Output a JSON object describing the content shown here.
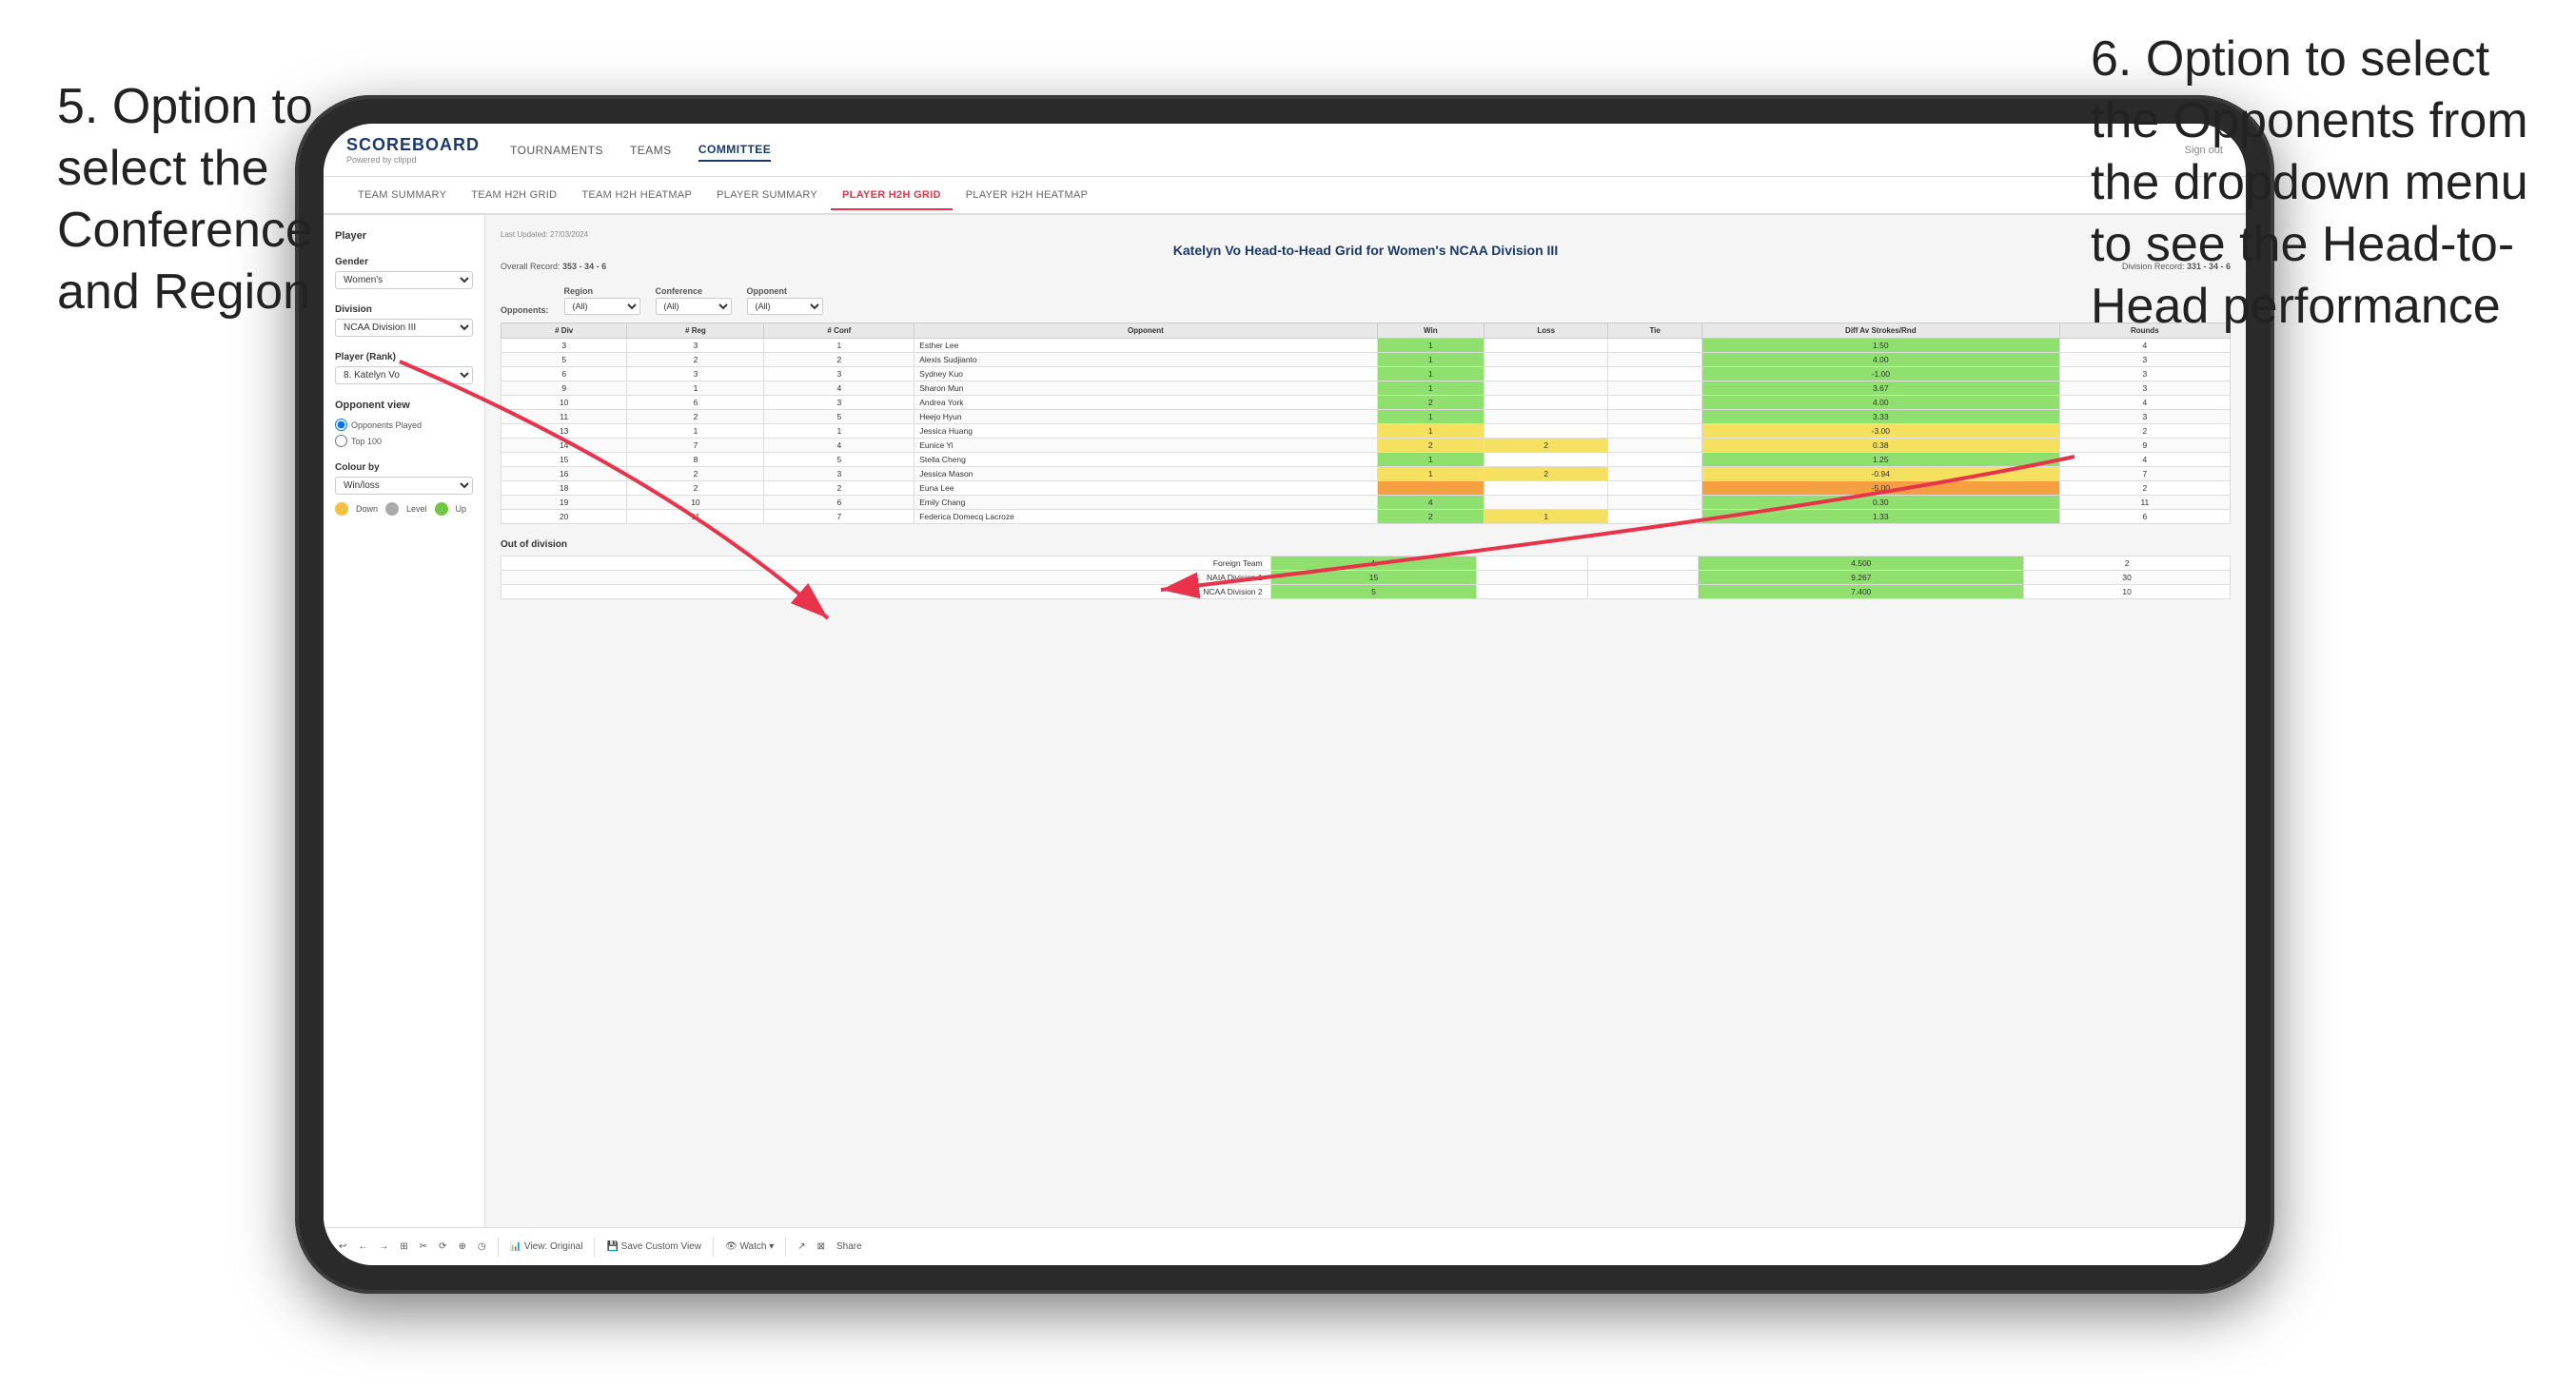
{
  "annotations": {
    "left": {
      "text": "5. Option to select the Conference and Region"
    },
    "right": {
      "text": "6. Option to select the Opponents from the dropdown menu to see the Head-to-Head performance"
    }
  },
  "nav": {
    "logo": "SCOREBOARD",
    "logo_sub": "Powered by clippd",
    "items": [
      "TOURNAMENTS",
      "TEAMS",
      "COMMITTEE"
    ],
    "active": "COMMITTEE",
    "sign_out": "Sign out"
  },
  "sub_nav": {
    "items": [
      "TEAM SUMMARY",
      "TEAM H2H GRID",
      "TEAM H2H HEATMAP",
      "PLAYER SUMMARY",
      "PLAYER H2H GRID",
      "PLAYER H2H HEATMAP"
    ],
    "active": "PLAYER H2H GRID"
  },
  "sidebar": {
    "player_label": "Player",
    "gender_label": "Gender",
    "gender_value": "Women's",
    "division_label": "Division",
    "division_value": "NCAA Division III",
    "player_rank_label": "Player (Rank)",
    "player_rank_value": "8. Katelyn Vo",
    "opponent_view_label": "Opponent view",
    "opponent_options": [
      "Opponents Played",
      "Top 100"
    ],
    "colour_by_label": "Colour by",
    "colour_by_value": "Win/loss",
    "colour_circles": [
      {
        "color": "#f5c040",
        "label": "Down"
      },
      {
        "color": "#aaaaaa",
        "label": "Level"
      },
      {
        "color": "#70c840",
        "label": "Up"
      }
    ]
  },
  "report": {
    "last_updated": "Last Updated: 27/03/2024",
    "title": "Katelyn Vo Head-to-Head Grid for Women's NCAA Division III",
    "overall_record_label": "Overall Record:",
    "overall_record": "353 - 34 - 6",
    "division_record_label": "Division Record:",
    "division_record": "331 - 34 - 6",
    "filters": {
      "opponents_label": "Opponents:",
      "region_label": "Region",
      "region_sublabel": "(All)",
      "conference_label": "Conference",
      "conference_sublabel": "(All)",
      "opponent_label": "Opponent",
      "opponent_sublabel": "(All)"
    },
    "table_headers": [
      "# Div",
      "# Reg",
      "# Conf",
      "Opponent",
      "Win",
      "Loss",
      "Tie",
      "Diff Av Strokes/Rnd",
      "Rounds"
    ],
    "rows": [
      {
        "div": "3",
        "reg": "3",
        "conf": "1",
        "opponent": "Esther Lee",
        "win": "1",
        "loss": "",
        "tie": "",
        "diff": "1.50",
        "rounds": "4",
        "win_color": "cell-green"
      },
      {
        "div": "5",
        "reg": "2",
        "conf": "2",
        "opponent": "Alexis Sudjianto",
        "win": "1",
        "loss": "",
        "tie": "",
        "diff": "4.00",
        "rounds": "3",
        "win_color": "cell-green"
      },
      {
        "div": "6",
        "reg": "3",
        "conf": "3",
        "opponent": "Sydney Kuo",
        "win": "1",
        "loss": "",
        "tie": "",
        "diff": "-1.00",
        "rounds": "3",
        "win_color": "cell-green"
      },
      {
        "div": "9",
        "reg": "1",
        "conf": "4",
        "opponent": "Sharon Mun",
        "win": "1",
        "loss": "",
        "tie": "",
        "diff": "3.67",
        "rounds": "3",
        "win_color": "cell-green"
      },
      {
        "div": "10",
        "reg": "6",
        "conf": "3",
        "opponent": "Andrea York",
        "win": "2",
        "loss": "",
        "tie": "",
        "diff": "4.00",
        "rounds": "4",
        "win_color": "cell-green"
      },
      {
        "div": "11",
        "reg": "2",
        "conf": "5",
        "opponent": "Heejo Hyun",
        "win": "1",
        "loss": "",
        "tie": "",
        "diff": "3.33",
        "rounds": "3",
        "win_color": "cell-green"
      },
      {
        "div": "13",
        "reg": "1",
        "conf": "1",
        "opponent": "Jessica Huang",
        "win": "1",
        "loss": "",
        "tie": "",
        "diff": "-3.00",
        "rounds": "2",
        "win_color": "cell-yellow"
      },
      {
        "div": "14",
        "reg": "7",
        "conf": "4",
        "opponent": "Eunice Yi",
        "win": "2",
        "loss": "2",
        "tie": "",
        "diff": "0.38",
        "rounds": "9",
        "win_color": "cell-yellow"
      },
      {
        "div": "15",
        "reg": "8",
        "conf": "5",
        "opponent": "Stella Cheng",
        "win": "1",
        "loss": "",
        "tie": "",
        "diff": "1.25",
        "rounds": "4",
        "win_color": "cell-green"
      },
      {
        "div": "16",
        "reg": "2",
        "conf": "3",
        "opponent": "Jessica Mason",
        "win": "1",
        "loss": "2",
        "tie": "",
        "diff": "-0.94",
        "rounds": "7",
        "win_color": "cell-yellow"
      },
      {
        "div": "18",
        "reg": "2",
        "conf": "2",
        "opponent": "Euna Lee",
        "win": "",
        "loss": "",
        "tie": "",
        "diff": "-5.00",
        "rounds": "2",
        "win_color": "cell-orange"
      },
      {
        "div": "19",
        "reg": "10",
        "conf": "6",
        "opponent": "Emily Chang",
        "win": "4",
        "loss": "",
        "tie": "",
        "diff": "0.30",
        "rounds": "11",
        "win_color": "cell-green"
      },
      {
        "div": "20",
        "reg": "11",
        "conf": "7",
        "opponent": "Federica Domecq Lacroze",
        "win": "2",
        "loss": "1",
        "tie": "",
        "diff": "1.33",
        "rounds": "6",
        "win_color": "cell-green"
      }
    ],
    "out_of_division_title": "Out of division",
    "out_of_division_rows": [
      {
        "name": "Foreign Team",
        "win": "1",
        "loss": "",
        "tie": "",
        "diff": "4.500",
        "rounds": "2"
      },
      {
        "name": "NAIA Division 1",
        "win": "15",
        "loss": "",
        "tie": "",
        "diff": "9.267",
        "rounds": "30"
      },
      {
        "name": "NCAA Division 2",
        "win": "5",
        "loss": "",
        "tie": "",
        "diff": "7.400",
        "rounds": "10"
      }
    ]
  },
  "toolbar": {
    "items": [
      "↩",
      "←",
      "→",
      "⊞",
      "✂",
      "⟳",
      "⊕",
      "◷",
      "View: Original",
      "Save Custom View",
      "Watch ▾",
      "↗",
      "⊠",
      "Share"
    ]
  }
}
